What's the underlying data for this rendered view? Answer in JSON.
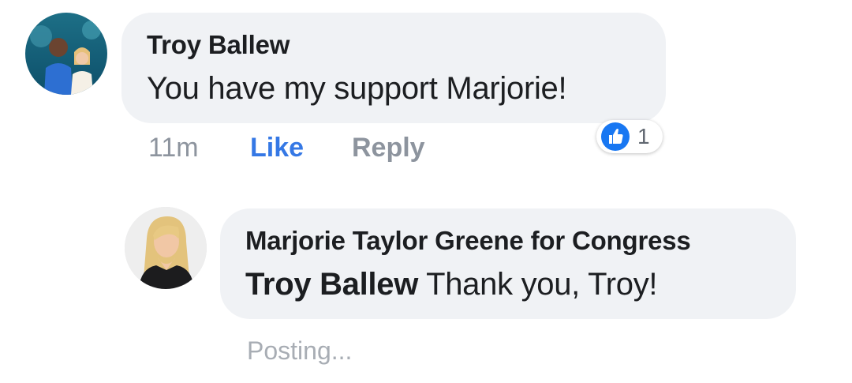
{
  "comment": {
    "author": "Troy Ballew",
    "text": "You have my support Marjorie!",
    "time": "11m",
    "like_label": "Like",
    "reply_label": "Reply",
    "reaction_count": "1",
    "reaction_icon": "thumbs-up-icon"
  },
  "reply": {
    "author": "Marjorie Taylor Greene for Congress",
    "mention": "Troy Ballew",
    "text": " Thank you, Troy!",
    "status": "Posting..."
  },
  "colors": {
    "bubble": "#f0f2f5",
    "like_blue": "#3578e5",
    "muted": "#8d949e"
  }
}
